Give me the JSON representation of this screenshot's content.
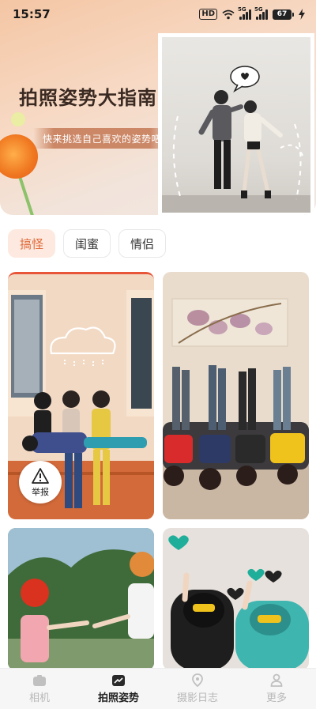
{
  "status_bar": {
    "time": "15:57",
    "hd": "HD",
    "sig1_tag": "5G",
    "sig2_tag": "5G",
    "battery": "67"
  },
  "banner": {
    "title": "拍照姿势大指南",
    "subtitle": "快来挑选自己喜欢的姿势吧"
  },
  "tabs": [
    {
      "label": "搞怪",
      "active": true
    },
    {
      "label": "闺蜜",
      "active": false
    },
    {
      "label": "情侣",
      "active": false
    }
  ],
  "cards": {
    "report_label": "举报"
  },
  "bottom_nav": [
    {
      "label": "相机",
      "icon": "camera-icon",
      "active": false
    },
    {
      "label": "拍照姿势",
      "icon": "pose-icon",
      "active": true
    },
    {
      "label": "摄影日志",
      "icon": "location-pin-icon",
      "active": false
    },
    {
      "label": "更多",
      "icon": "person-icon",
      "active": false
    }
  ],
  "colors": {
    "accent": "#e06a3a",
    "tab_active_bg": "#fde9df",
    "card_top_bar": "#e8563a"
  }
}
